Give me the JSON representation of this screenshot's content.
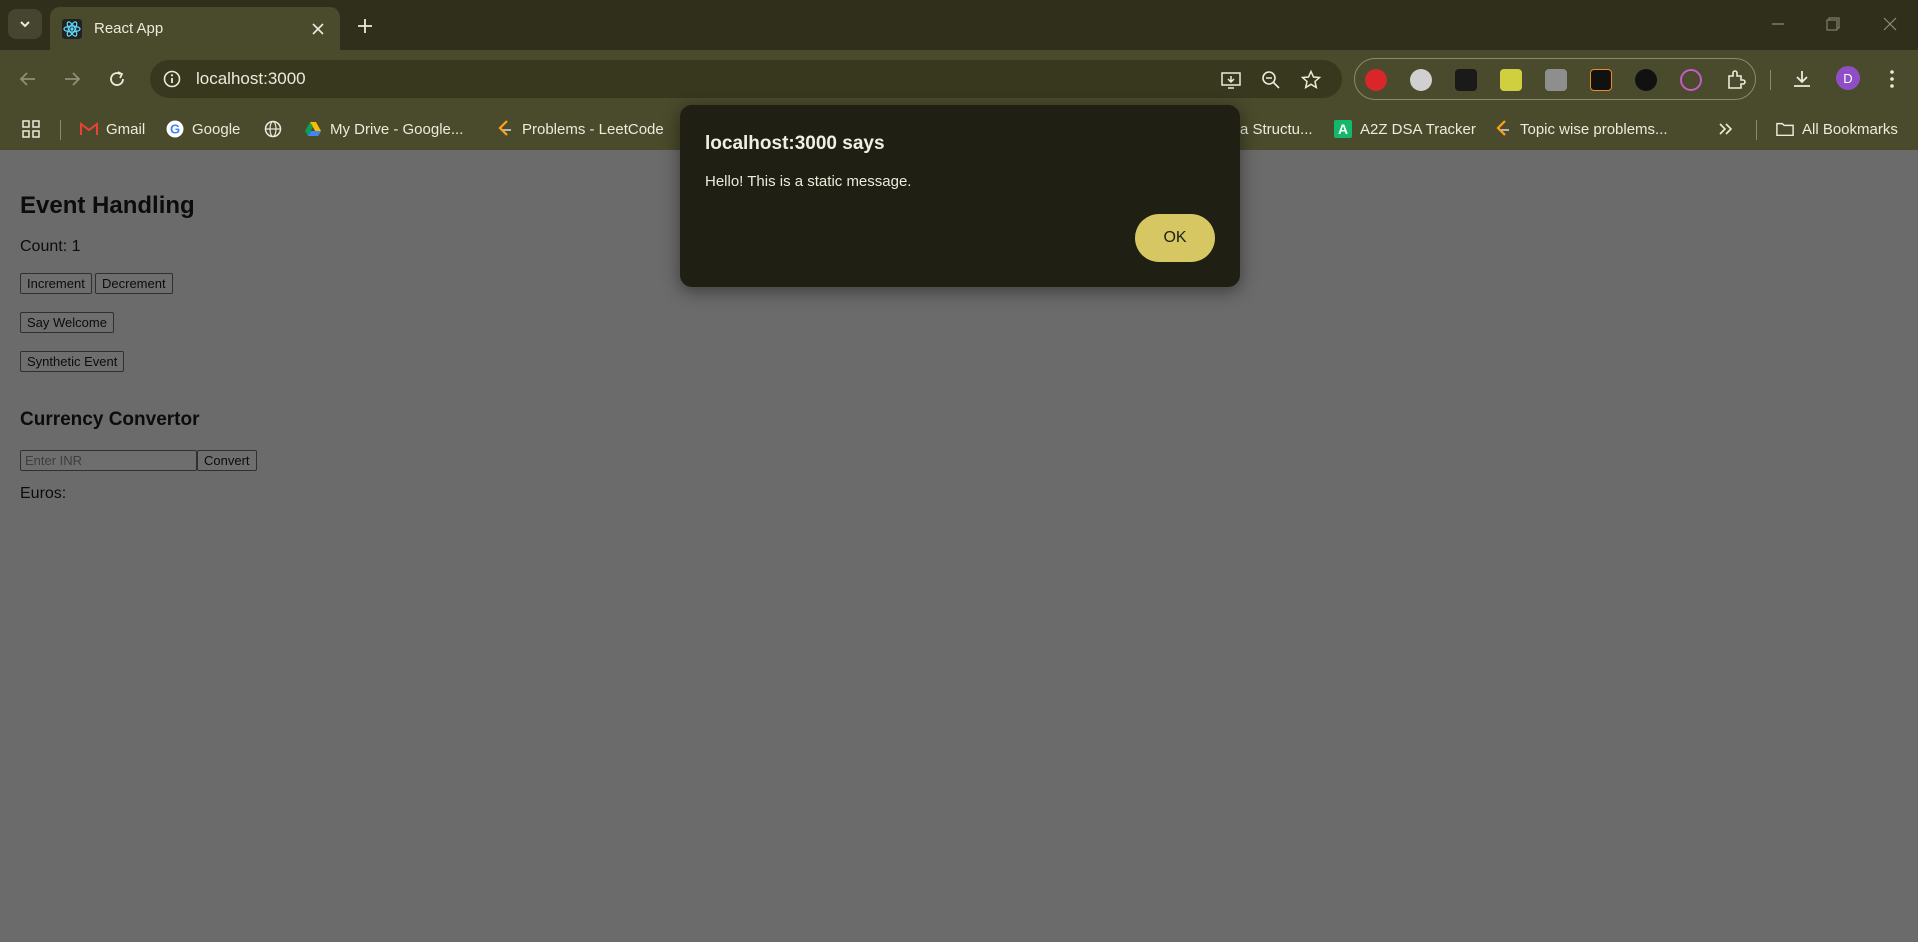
{
  "browser": {
    "tab": {
      "title": "React App",
      "favicon": "react-icon"
    },
    "address": {
      "url": "localhost:3000"
    },
    "profile_initial": "D",
    "bookmarks": [
      {
        "label": "",
        "icon": "apps-grid-icon"
      },
      {
        "label": "Gmail",
        "icon": "gmail-icon"
      },
      {
        "label": "Google",
        "icon": "google-icon"
      },
      {
        "label": "",
        "icon": "globe-icon"
      },
      {
        "label": "My Drive - Google...",
        "icon": "drive-icon"
      },
      {
        "label": "Problems - LeetCode",
        "icon": "leetcode-icon"
      },
      {
        "label": "a Structu...",
        "icon": ""
      },
      {
        "label": "A2Z DSA Tracker",
        "icon": "a2z-icon"
      },
      {
        "label": "Topic wise problems...",
        "icon": "leetcode-icon"
      }
    ],
    "all_bookmarks": "All Bookmarks"
  },
  "page": {
    "heading": "Event Handling",
    "count_text": "Count: 1",
    "buttons": {
      "increment": "Increment",
      "decrement": "Decrement",
      "say_welcome": "Say Welcome",
      "synthetic_event": "Synthetic Event"
    },
    "currency_heading": "Currency Convertor",
    "inr_placeholder": "Enter INR",
    "convert": "Convert",
    "euros_text": "Euros:"
  },
  "dialog": {
    "title": "localhost:3000 says",
    "message": "Hello! This is a static message.",
    "ok": "OK"
  },
  "colors": {
    "chrome_dark": "#2f2f1c",
    "chrome": "#4a4a2c",
    "dialog_bg": "#1f1f13",
    "ok_button": "#d7c763",
    "page_dimmed": "#6b6b6b"
  }
}
